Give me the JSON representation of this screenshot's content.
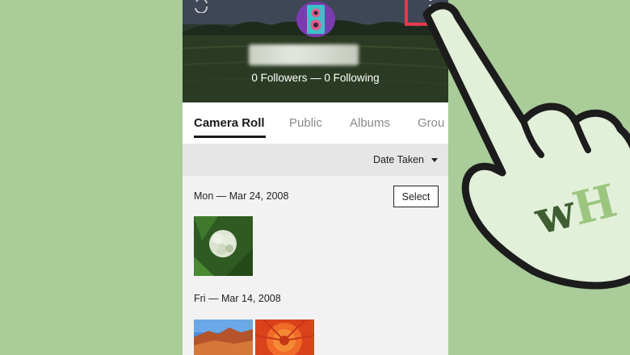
{
  "profile": {
    "follow_counts": "0 Followers — 0 Following"
  },
  "tabs": [
    {
      "label": "Camera Roll",
      "active": true
    },
    {
      "label": "Public",
      "active": false
    },
    {
      "label": "Albums",
      "active": false
    },
    {
      "label": "Grou",
      "active": false
    }
  ],
  "sort": {
    "label": "Date Taken"
  },
  "sections": [
    {
      "date": "Mon — Mar 24, 2008",
      "select_label": "Select"
    },
    {
      "date": "Fri — Mar 14, 2008"
    }
  ],
  "watermark": {
    "text": "wH"
  },
  "colors": {
    "background": "#a9cc99",
    "highlight": "#e43a4d",
    "avatar": "#7a3bb0"
  }
}
